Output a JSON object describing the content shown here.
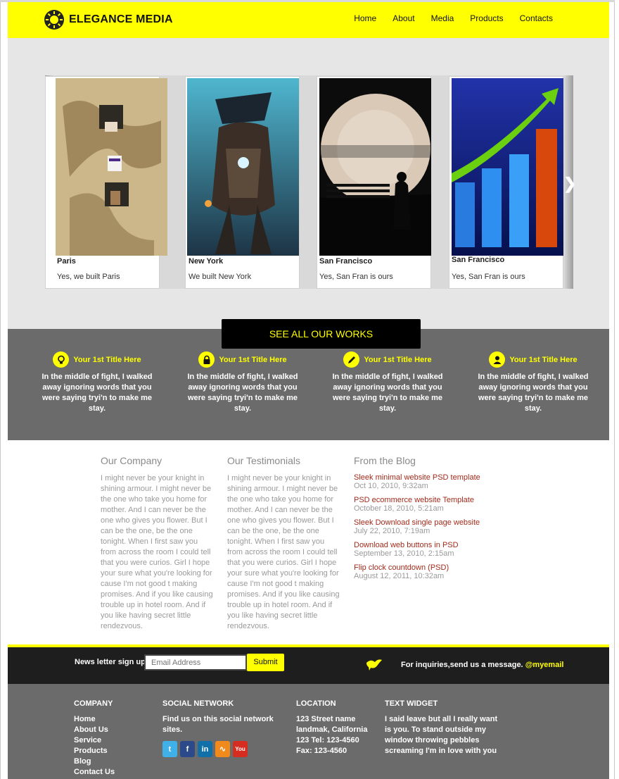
{
  "brand": {
    "name": "ELEGANCE MEDIA"
  },
  "nav": {
    "items": [
      "Home",
      "About",
      "Media",
      "Products",
      "Contacts"
    ]
  },
  "slider": {
    "cards": [
      {
        "title": "Paris",
        "desc": "Yes, we built Paris"
      },
      {
        "title": "New York",
        "desc": "We built New York"
      },
      {
        "title": "San Francisco",
        "desc": "Yes, San Fran is ours"
      },
      {
        "title": "San Francisco",
        "desc": "Yes, San Fran is ours"
      }
    ],
    "cta": "SEE ALL OUR WORKS"
  },
  "features": [
    {
      "icon": "lightbulb-icon",
      "title": "Your 1st Title Here",
      "text": "In the middle of fight, I walked away ignoring words that you were saying tryi'n to make me stay."
    },
    {
      "icon": "lock-icon",
      "title": "Your 1st Title Here",
      "text": "In the middle of fight, I walked away ignoring words that you were saying tryi'n to make me stay."
    },
    {
      "icon": "pencil-icon",
      "title": "Your 1st Title Here",
      "text": "In the middle of fight, I walked away ignoring words that you were saying tryi'n to make me stay."
    },
    {
      "icon": "user-icon",
      "title": "Your 1st Title Here",
      "text": "In the middle of fight, I walked away ignoring words that you were saying tryi'n to make me stay."
    }
  ],
  "company": {
    "heading": "Our Company",
    "text": "I might never be your knight in shining armour. I might never be the one who take you home for mother. And I can never be the one who gives you flower. But I can be the one, be the one tonight. When I first saw you from across the room I could tell that you were curios. Girl I hope your sure what you're looking for cause I'm not good t making promises. And if you like causing trouble up in hotel room. And if you like having secret little rendezvous."
  },
  "testimonials": {
    "heading": "Our Testimonials",
    "text": "I might never be your knight in shining armour. I might never be the one who take you home for mother. And I can never be the one who gives you flower. But I can be the one, be the one tonight. When I first saw you from across the room I could tell that you were curios. Girl I hope your sure what you're looking for cause I'm not good t making promises. And if you like causing trouble up in hotel room. And if you like having secret little rendezvous."
  },
  "blog": {
    "heading": "From the Blog",
    "posts": [
      {
        "title": "Sleek minimal website PSD template",
        "date": "Oct 10, 2010, 9:32am"
      },
      {
        "title": "PSD ecommerce website Template",
        "date": "October 18, 2010, 5:21am"
      },
      {
        "title": "Sleek Download single page website",
        "date": "July 22, 2010, 7:19am"
      },
      {
        "title": "Download web buttons in PSD",
        "date": "September 13, 2010, 2:15am"
      },
      {
        "title": "Flip clock countdown (PSD)",
        "date": "August 12, 2011, 10:32am"
      }
    ]
  },
  "newsletter": {
    "label": "News letter sign up",
    "placeholder": "Email Address",
    "button": "Submit",
    "inquiry": "For inquiries,send us a message.",
    "handle": "@myemail"
  },
  "footer": {
    "company": {
      "heading": "COMPANY",
      "links": [
        "Home",
        "About Us",
        "Service",
        "Products",
        "Blog",
        "Contact Us"
      ]
    },
    "social": {
      "heading": "SOCIAL NETWORK",
      "text": "Find us on this social network sites.",
      "icons": [
        "twitter-icon",
        "facebook-icon",
        "linkedin-icon",
        "rss-icon",
        "youtube-icon"
      ]
    },
    "location": {
      "heading": "LOCATION",
      "lines": [
        "123 Street name",
        "landmak, California",
        "123 Tel: 123-4560",
        "Fax: 123-4560"
      ]
    },
    "widget": {
      "heading": "TEXT WIDGET",
      "text": "I said leave but all I really want is you. To stand outside my window throwing pebbles screaming I'm in love with you"
    }
  },
  "colors": {
    "accent": "#ffff00",
    "dark": "#1e1e1e",
    "gray": "#6b6b6b",
    "link": "#a32b1b"
  }
}
